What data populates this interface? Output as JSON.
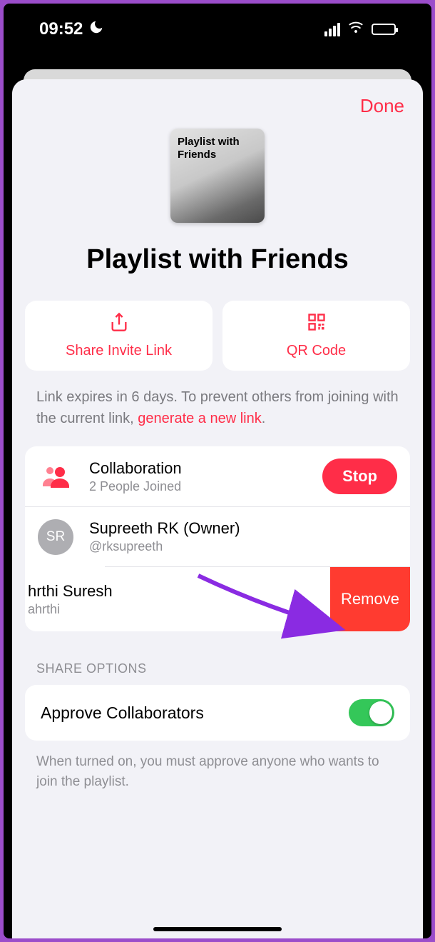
{
  "status": {
    "time": "09:52"
  },
  "sheet": {
    "done_label": "Done",
    "artwork_text": "Playlist with Friends",
    "playlist_title": "Playlist with Friends",
    "share_link_label": "Share Invite Link",
    "qr_label": "QR Code",
    "help_prefix": "Link expires in 6 days. To prevent others from joining with the current link, ",
    "help_link": "generate a new link",
    "help_suffix": "."
  },
  "collab": {
    "header": "Collaboration",
    "joined": "2 People Joined",
    "stop_label": "Stop",
    "owner_name": "Supreeth RK (Owner)",
    "owner_handle": "@rksupreeth",
    "owner_initials": "SR",
    "member_name": "hrthi Suresh",
    "member_handle": "ahrthi",
    "remove_label": "Remove"
  },
  "options": {
    "section": "SHARE OPTIONS",
    "approve_label": "Approve Collaborators",
    "approve_help": "When turned on, you must approve anyone who wants to join the playlist."
  }
}
